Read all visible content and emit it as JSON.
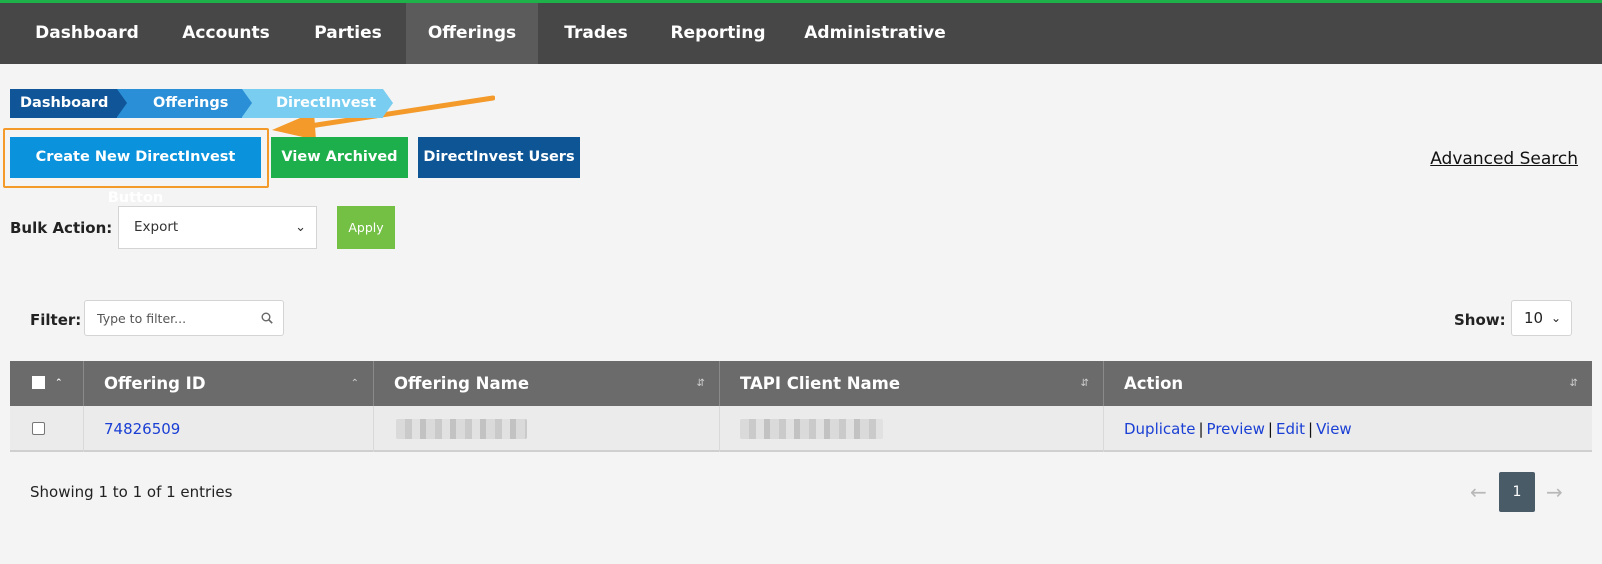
{
  "nav": {
    "items": [
      {
        "label": "Dashboard"
      },
      {
        "label": "Accounts"
      },
      {
        "label": "Parties"
      },
      {
        "label": "Offerings",
        "active": true
      },
      {
        "label": "Trades"
      },
      {
        "label": "Reporting"
      },
      {
        "label": "Administrative"
      }
    ]
  },
  "breadcrumb": [
    "Dashboard",
    "Offerings",
    "DirectInvest"
  ],
  "buttons": {
    "create": "Create New DirectInvest Button",
    "archived": "View Archived",
    "users": "DirectInvest Users",
    "advanced_search": "Advanced Search"
  },
  "bulk": {
    "label": "Bulk Action:",
    "selected": "Export",
    "apply": "Apply"
  },
  "filter": {
    "label": "Filter:",
    "placeholder": "Type to filter..."
  },
  "show": {
    "label": "Show:",
    "value": "10"
  },
  "table": {
    "headers": [
      "Offering ID",
      "Offering Name",
      "TAPI Client Name",
      "Action"
    ],
    "rows": [
      {
        "offering_id": "74826509",
        "actions": [
          "Duplicate",
          "Preview",
          "Edit",
          "View"
        ]
      }
    ]
  },
  "footer": {
    "showing": "Showing 1 to 1 of 1 entries",
    "prev": "←",
    "page": "1",
    "next": "→"
  },
  "colors": {
    "nav_bg": "#474747",
    "accent_green": "#1fb24a",
    "create_btn": "#0a93dc",
    "archived_btn": "#1daf4b",
    "users_btn": "#0d5594",
    "highlight": "#f39a2a",
    "link": "#1a3fd4"
  }
}
